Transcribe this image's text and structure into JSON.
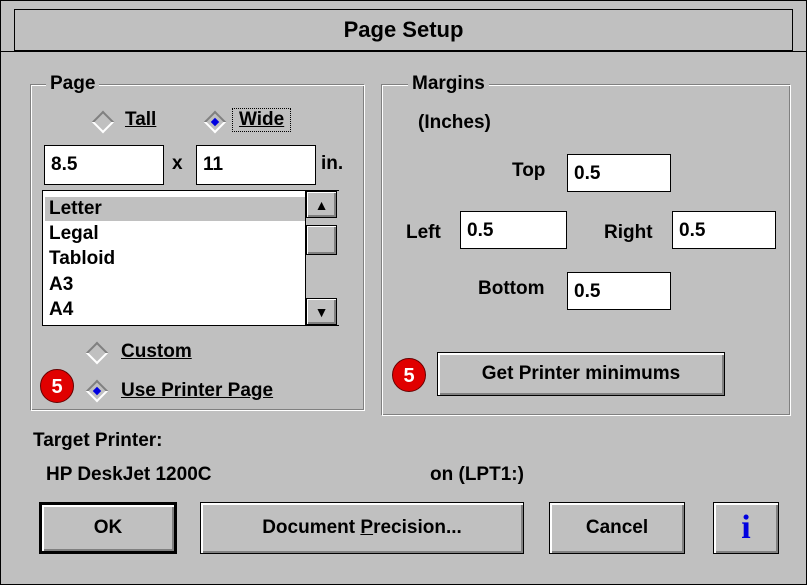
{
  "dialog": {
    "title": "Page Setup"
  },
  "page_group": {
    "legend": "Page",
    "orientation": {
      "tall_label": "Tall",
      "wide_label": "Wide",
      "selected": "Wide"
    },
    "width_value": "8.5",
    "times": "x",
    "height_value": "11",
    "unit": "in.",
    "paper_list": [
      "Letter",
      "Legal",
      "Tabloid",
      "A3",
      "A4"
    ],
    "paper_selected": "Letter",
    "custom_label": "Custom",
    "use_printer_page_label": "Use Printer Page",
    "source_selected": "Use Printer Page"
  },
  "margins_group": {
    "legend": "Margins",
    "units_note": "(Inches)",
    "top_label": "Top",
    "top_value": "0.5",
    "left_label": "Left",
    "left_value": "0.5",
    "right_label": "Right",
    "right_value": "0.5",
    "bottom_label": "Bottom",
    "bottom_value": "0.5",
    "get_minimums_label": "Get Printer minimums"
  },
  "badges": {
    "page_badge": "5",
    "margins_badge": "5",
    "color": "#e00000"
  },
  "target_printer": {
    "label": "Target Printer:",
    "name": "HP DeskJet 1200C",
    "port": "on (LPT1:)"
  },
  "buttons": {
    "ok": "OK",
    "precision": "Document Precision...",
    "cancel": "Cancel",
    "info_icon": "i"
  },
  "colors": {
    "face": "#c0c0c0",
    "radio_selected": "#0000e0",
    "info_icon": "#0000e0"
  }
}
